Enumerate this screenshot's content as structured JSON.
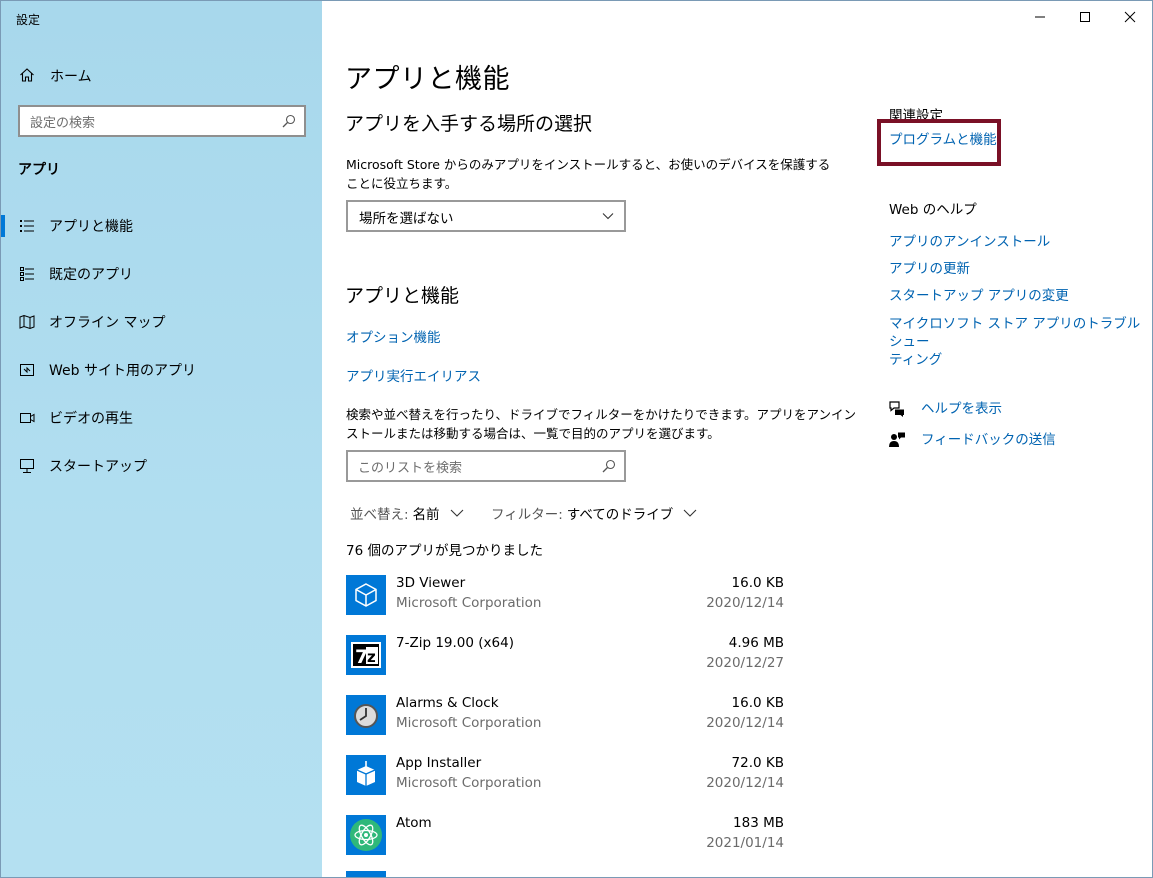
{
  "window": {
    "title": "設定"
  },
  "sidebar": {
    "home_label": "ホーム",
    "search_placeholder": "設定の検索",
    "section_title": "アプリ",
    "items": [
      {
        "label": "アプリと機能",
        "icon": "apps-features-icon",
        "selected": true
      },
      {
        "label": "既定のアプリ",
        "icon": "default-apps-icon",
        "selected": false
      },
      {
        "label": "オフライン マップ",
        "icon": "offline-maps-icon",
        "selected": false
      },
      {
        "label": "Web サイト用のアプリ",
        "icon": "apps-for-websites-icon",
        "selected": false
      },
      {
        "label": "ビデオの再生",
        "icon": "video-playback-icon",
        "selected": false
      },
      {
        "label": "スタートアップ",
        "icon": "startup-icon",
        "selected": false
      }
    ]
  },
  "main": {
    "page_title": "アプリと機能",
    "install_section": {
      "title": "アプリを入手する場所の選択",
      "description_line1": "Microsoft Store からのみアプリをインストールすると、お使いのデバイスを保護する",
      "description_line2": "ことに役立ちます。",
      "dropdown_value": "場所を選ばない"
    },
    "apps_section": {
      "title": "アプリと機能",
      "link_optional": "オプション機能",
      "link_alias": "アプリ実行エイリアス",
      "description_line1": "検索や並べ替えを行ったり、ドライブでフィルターをかけたりできます。アプリをアンイン",
      "description_line2": "ストールまたは移動する場合は、一覧で目的のアプリを選びます。",
      "search_placeholder": "このリストを検索",
      "sort_key": "並べ替え:",
      "sort_value": "名前",
      "filter_key": "フィルター:",
      "filter_value": "すべてのドライブ",
      "count_text": "76 個のアプリが見つかりました"
    },
    "apps": [
      {
        "name": "3D Viewer",
        "publisher": "Microsoft Corporation",
        "size": "16.0 KB",
        "date": "2020/12/14",
        "icon": "3d-viewer-icon"
      },
      {
        "name": "7-Zip 19.00 (x64)",
        "publisher": "",
        "size": "4.96 MB",
        "date": "2020/12/27",
        "icon": "7zip-icon"
      },
      {
        "name": "Alarms & Clock",
        "publisher": "Microsoft Corporation",
        "size": "16.0 KB",
        "date": "2020/12/14",
        "icon": "alarms-clock-icon"
      },
      {
        "name": "App Installer",
        "publisher": "Microsoft Corporation",
        "size": "72.0 KB",
        "date": "2020/12/14",
        "icon": "app-installer-icon"
      },
      {
        "name": "Atom",
        "publisher": "",
        "size": "183 MB",
        "date": "2021/01/14",
        "icon": "atom-icon"
      }
    ]
  },
  "related": {
    "heading": "関連設定",
    "programs_link": "プログラムと機能",
    "web_help_heading": "Web のヘルプ",
    "web_links": [
      "アプリのアンインストール",
      "アプリの更新",
      "スタートアップ アプリの変更"
    ],
    "troubleshoot_line1": "マイクロソフト ストア アプリのトラブルシュー",
    "troubleshoot_line2": "ティング",
    "help_link": "ヘルプを表示",
    "feedback_link": "フィードバックの送信"
  },
  "colors": {
    "accent": "#0078d7",
    "link": "#0063b1",
    "highlight_border": "#7a1026",
    "app_tile": "#0078d7"
  }
}
